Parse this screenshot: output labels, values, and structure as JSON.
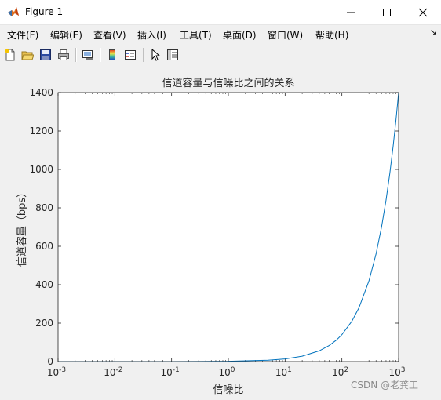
{
  "window": {
    "title": "Figure 1",
    "controls": [
      "minimize",
      "maximize",
      "close"
    ]
  },
  "menu": [
    "文件(F)",
    "编辑(E)",
    "查看(V)",
    "插入(I)",
    "工具(T)",
    "桌面(D)",
    "窗口(W)",
    "帮助(H)"
  ],
  "menu_overflow": "↘",
  "toolbar": {
    "icons": [
      "new-file-icon",
      "open-folder-icon",
      "save-icon",
      "print-icon",
      "link-plot-icon",
      "colorbar-icon",
      "legend-icon",
      "pointer-icon",
      "property-editor-icon"
    ]
  },
  "colors": {
    "line": "#0072bd",
    "axes_bg": "#ffffff",
    "figure_bg": "#f0f0f0",
    "text": "#262626"
  },
  "chart_data": {
    "type": "line",
    "title": "信道容量与信噪比之间的关系",
    "xlabel": "信噪比",
    "ylabel": "信道容量（bps）",
    "xscale": "log",
    "xlim": [
      0.001,
      1000
    ],
    "ylim": [
      0,
      1400
    ],
    "xticks": [
      {
        "value": 0.001,
        "base": "10",
        "exp": "-3"
      },
      {
        "value": 0.01,
        "base": "10",
        "exp": "-2"
      },
      {
        "value": 0.1,
        "base": "10",
        "exp": "-1"
      },
      {
        "value": 1,
        "base": "10",
        "exp": "0"
      },
      {
        "value": 10,
        "base": "10",
        "exp": "1"
      },
      {
        "value": 100,
        "base": "10",
        "exp": "2"
      },
      {
        "value": 1000,
        "base": "10",
        "exp": "3"
      }
    ],
    "yticks": [
      0,
      200,
      400,
      600,
      800,
      1000,
      1200,
      1400
    ],
    "grid": false,
    "series": [
      {
        "color": "#0072bd",
        "x": [
          0.001,
          0.01,
          0.1,
          1,
          5,
          10,
          20,
          40,
          60,
          80,
          100,
          150,
          200,
          300,
          400,
          500,
          600,
          700,
          800,
          900,
          1000
        ],
        "y": [
          0.001,
          0.014,
          0.14,
          1.4,
          7,
          14,
          28,
          56,
          84,
          112,
          140,
          210,
          280,
          420,
          560,
          700,
          840,
          980,
          1120,
          1260,
          1400
        ]
      }
    ]
  },
  "watermark": "CSDN @老龚工"
}
